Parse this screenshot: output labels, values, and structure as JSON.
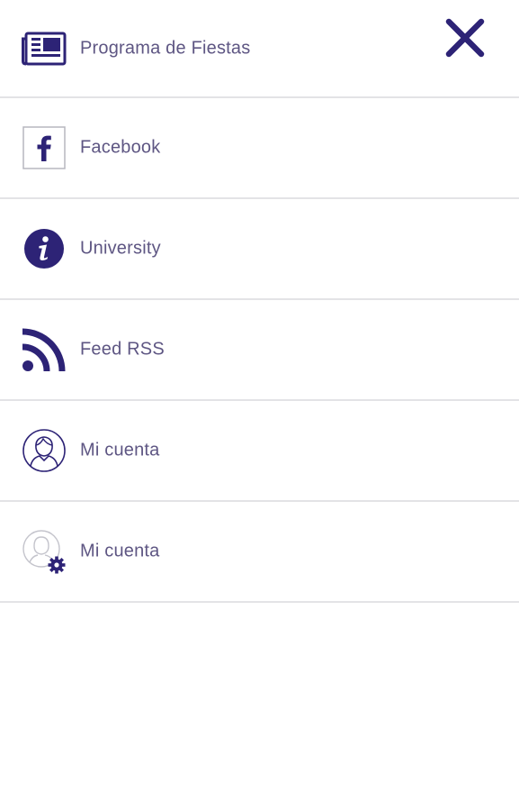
{
  "theme": {
    "accent": "#2d2376",
    "label_color": "#5e5683",
    "divider": "#e3e3e6",
    "background": "#ffffff"
  },
  "close_icon": "close-icon",
  "menu": {
    "items": [
      {
        "label": "Programa de Fiestas",
        "icon": "newspaper-icon"
      },
      {
        "label": "Facebook",
        "icon": "facebook-icon"
      },
      {
        "label": "University",
        "icon": "info-icon"
      },
      {
        "label": "Feed RSS",
        "icon": "rss-icon"
      },
      {
        "label": "Mi cuenta",
        "icon": "user-profile-icon"
      },
      {
        "label": "Mi cuenta",
        "icon": "user-settings-icon"
      }
    ]
  }
}
